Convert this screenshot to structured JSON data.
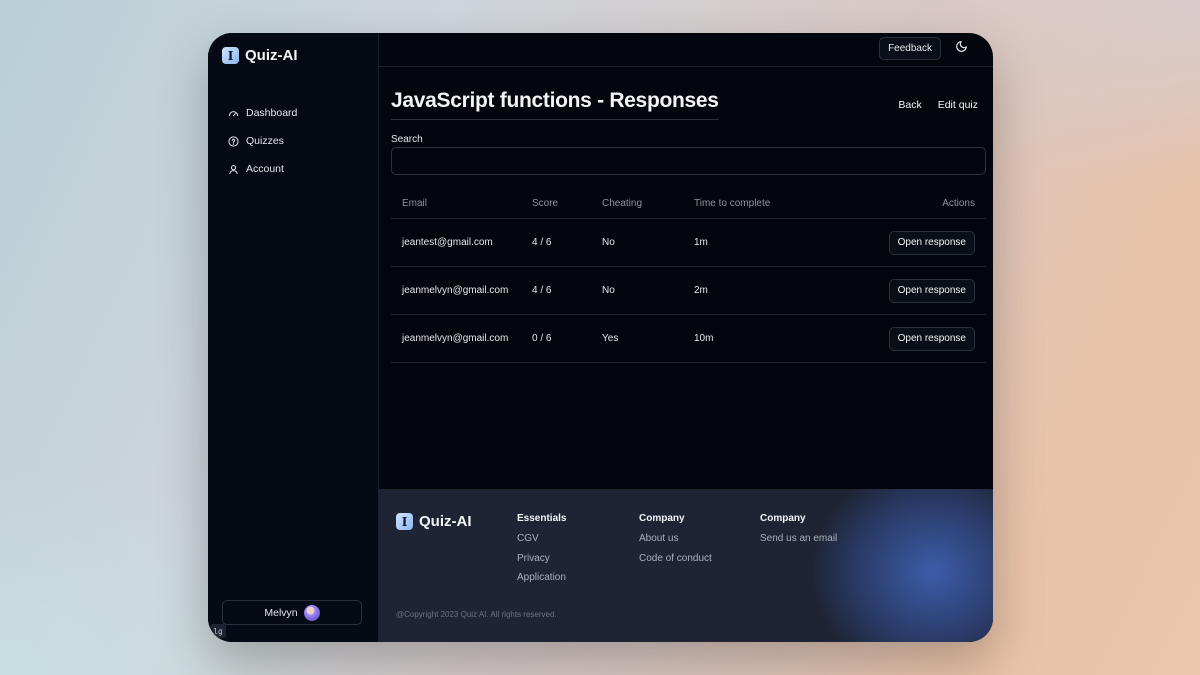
{
  "app": {
    "name": "Quiz-AI",
    "logo_glyph": "I"
  },
  "sidebar": {
    "items": [
      {
        "label": "Dashboard",
        "icon": "gauge-icon"
      },
      {
        "label": "Quizzes",
        "icon": "question-circle-icon"
      },
      {
        "label": "Account",
        "icon": "user-icon"
      }
    ],
    "user_name": "Melvyn",
    "badge": "lg"
  },
  "topbar": {
    "feedback_label": "Feedback",
    "theme_icon": "moon-icon"
  },
  "page": {
    "title": "JavaScript functions - Responses",
    "back_label": "Back",
    "edit_label": "Edit quiz"
  },
  "search": {
    "label": "Search",
    "value": ""
  },
  "table": {
    "headers": {
      "email": "Email",
      "score": "Score",
      "cheating": "Cheating",
      "time": "Time to complete",
      "actions": "Actions"
    },
    "rows": [
      {
        "email": "jeantest@gmail.com",
        "score": "4 / 6",
        "cheating": "No",
        "time": "1m",
        "action": "Open response"
      },
      {
        "email": "jeanmelvyn@gmail.com",
        "score": "4 / 6",
        "cheating": "No",
        "time": "2m",
        "action": "Open response"
      },
      {
        "email": "jeanmelvyn@gmail.com",
        "score": "0 / 6",
        "cheating": "Yes",
        "time": "10m",
        "action": "Open response"
      }
    ]
  },
  "footer": {
    "brand": "Quiz-AI",
    "columns": [
      {
        "heading": "Essentials",
        "links": [
          "CGV",
          "Privacy",
          "Application"
        ]
      },
      {
        "heading": "Company",
        "links": [
          "About us",
          "Code of conduct"
        ]
      },
      {
        "heading": "Company",
        "links": [
          "Send us an email"
        ]
      }
    ],
    "copyright": "@Copyright 2023 Quiz AI. All rights reserved."
  },
  "colors": {
    "accent": "#8eb7ee",
    "background": "#03060d",
    "footer": "#1e2433"
  }
}
